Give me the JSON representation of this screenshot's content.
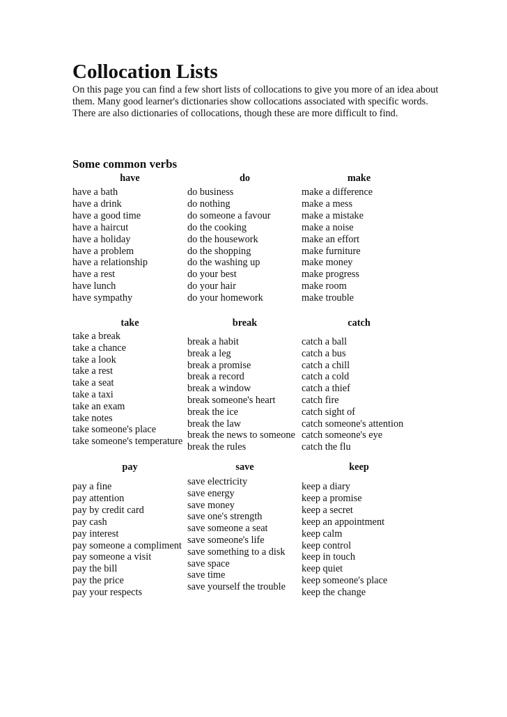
{
  "title": "Collocation Lists",
  "intro": "On this page you can find a few short lists of collocations to give you more of an idea about them. Many good learner's dictionaries show collocations associated with specific words. There are also dictionaries of collocations, though these are more difficult to find.",
  "section_heading": "Some common verbs",
  "groups": [
    {
      "verb": "have",
      "items": [
        "have a bath",
        "have a drink",
        "have a good time",
        "have a haircut",
        "have a holiday",
        "have a problem",
        "have a relationship",
        "have a rest",
        "have lunch",
        "have sympathy"
      ]
    },
    {
      "verb": "do",
      "items": [
        "do business",
        "do nothing",
        "do someone a favour",
        "do the cooking",
        "do the housework",
        "do the shopping",
        "do the washing up",
        "do your best",
        "do your hair",
        "do your homework"
      ]
    },
    {
      "verb": "make",
      "items": [
        "make a difference",
        "make a mess",
        "make a mistake",
        "make a noise",
        "make an effort",
        "make furniture",
        "make money",
        "make progress",
        "make room",
        "make trouble"
      ]
    },
    {
      "verb": "take",
      "items": [
        "take a break",
        "take a chance",
        "take a look",
        "take a rest",
        "take a seat",
        "take a taxi",
        "take an exam",
        "take notes",
        "take someone's place",
        "take someone's temperature"
      ]
    },
    {
      "verb": "break",
      "items": [
        "break a habit",
        "break a leg",
        "break a promise",
        "break a record",
        "break a window",
        "break someone's heart",
        "break the ice",
        "break the law",
        "break the news to someone",
        "break the rules"
      ]
    },
    {
      "verb": "catch",
      "items": [
        "catch a ball",
        "catch a bus",
        "catch a chill",
        "catch a cold",
        "catch a thief",
        "catch fire",
        "catch sight of",
        "catch someone's attention",
        "catch someone's eye",
        "catch the flu"
      ]
    },
    {
      "verb": "pay",
      "items": [
        "pay a fine",
        "pay attention",
        "pay by credit card",
        "pay cash",
        "pay interest",
        "pay someone a compliment",
        "pay someone a visit",
        "pay the bill",
        "pay the price",
        "pay your respects"
      ]
    },
    {
      "verb": "save",
      "items": [
        "save electricity",
        "save energy",
        "save money",
        "save one's strength",
        "save someone a seat",
        "save someone's life",
        "save something to a disk",
        "save space",
        "save time",
        "save yourself the trouble"
      ]
    },
    {
      "verb": "keep",
      "items": [
        "keep a diary",
        "keep a promise",
        "keep a secret",
        "keep an appointment",
        "keep calm",
        "keep control",
        "keep in touch",
        "keep quiet",
        "keep someone's place",
        "keep the change"
      ]
    }
  ]
}
